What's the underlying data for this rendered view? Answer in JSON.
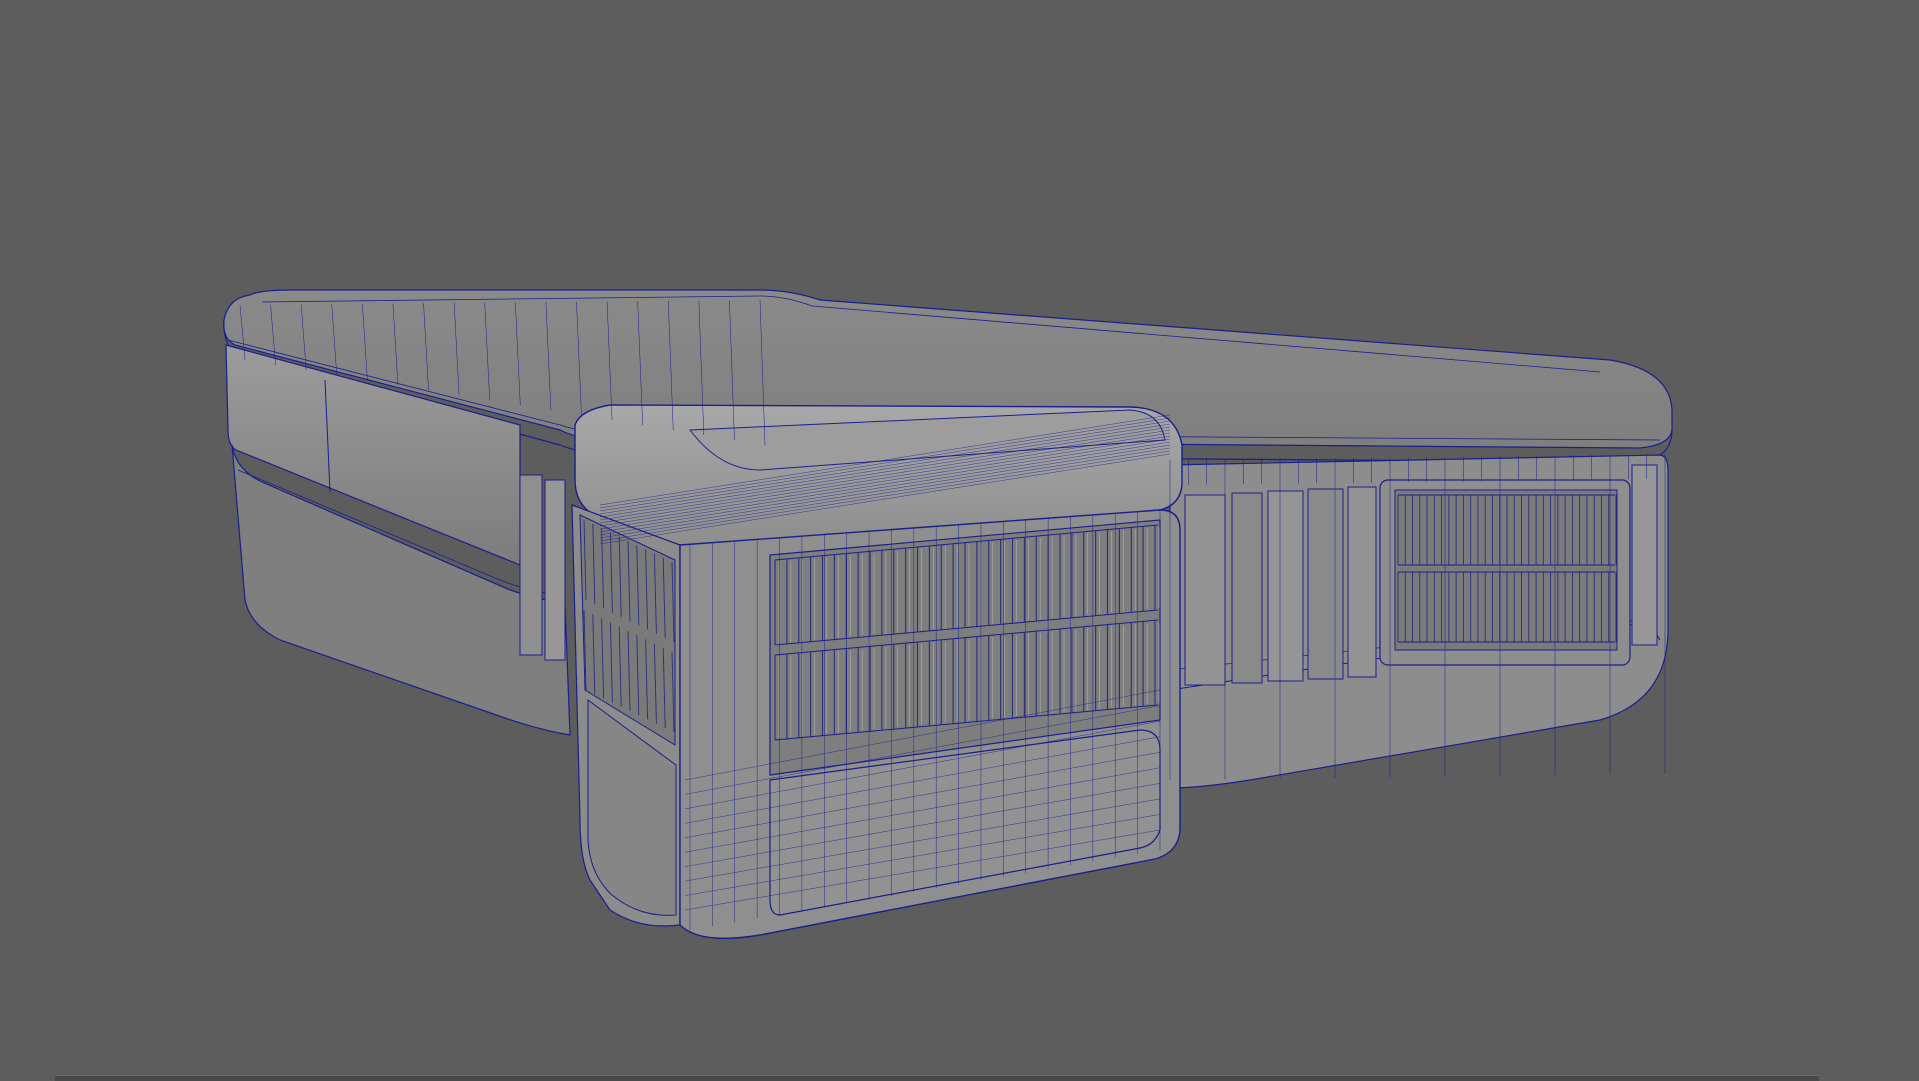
{
  "viewport": {
    "background_color": "#5d5d5d",
    "display_mode": "wireframe-on-shaded",
    "wire_color": "#1a1f8c",
    "surface_color": "#8c8c8c",
    "surface_light_color": "#a3a3a3",
    "surface_dark_color": "#6e6e6e"
  },
  "model": {
    "object": "rugged-case-with-corner-bumper",
    "parts": [
      "main-body",
      "top-lid",
      "corner-bumper",
      "front-grille-panel",
      "side-grille-panel",
      "side-ribs"
    ]
  }
}
